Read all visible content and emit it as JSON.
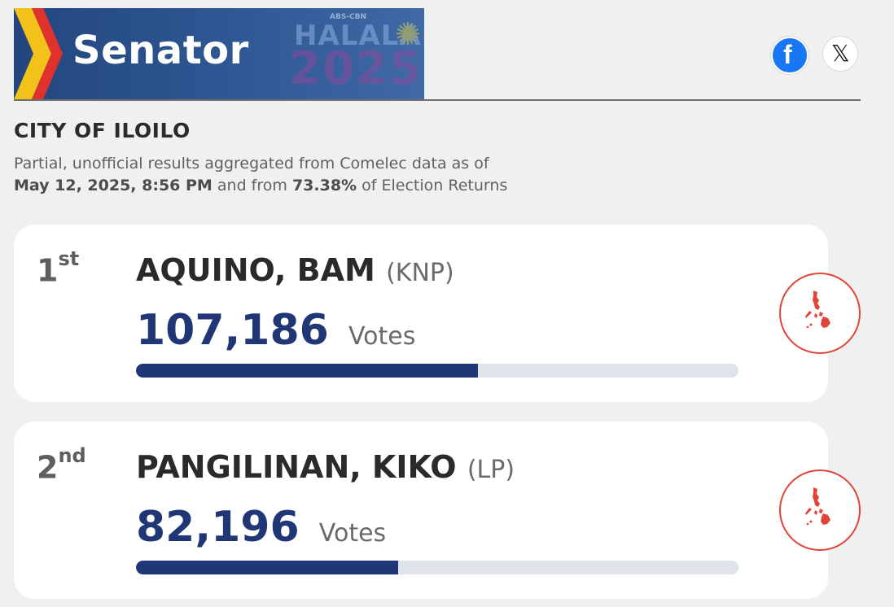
{
  "header": {
    "title": "Senator",
    "logo": {
      "brand": "ABS-CBN",
      "halalan": "HALALAN",
      "year": "2025"
    }
  },
  "social": {
    "facebook_icon": "facebook-icon",
    "x_icon": "x-icon"
  },
  "location": {
    "city": "CITY OF ILOILO",
    "note_line1": "Partial, unofficial results aggregated from Comelec data as of",
    "date": "May 12, 2025, 8:56 PM",
    "and_from": "and from",
    "percent": "73.38%",
    "of_returns": "of Election Returns"
  },
  "candidates": [
    {
      "rank_num": "1",
      "rank_suffix": "st",
      "name": "AQUINO, BAM",
      "party": "(KNP)",
      "votes": "107,186",
      "votes_label": "Votes",
      "bar_fraction": 0.568
    },
    {
      "rank_num": "2",
      "rank_suffix": "nd",
      "name": "PANGILINAN, KIKO",
      "party": "(LP)",
      "votes": "82,196",
      "votes_label": "Votes",
      "bar_fraction": 0.435
    }
  ],
  "colors": {
    "accent": "#213775",
    "map": "#e04538",
    "bar_track": "#dfe3ea"
  }
}
